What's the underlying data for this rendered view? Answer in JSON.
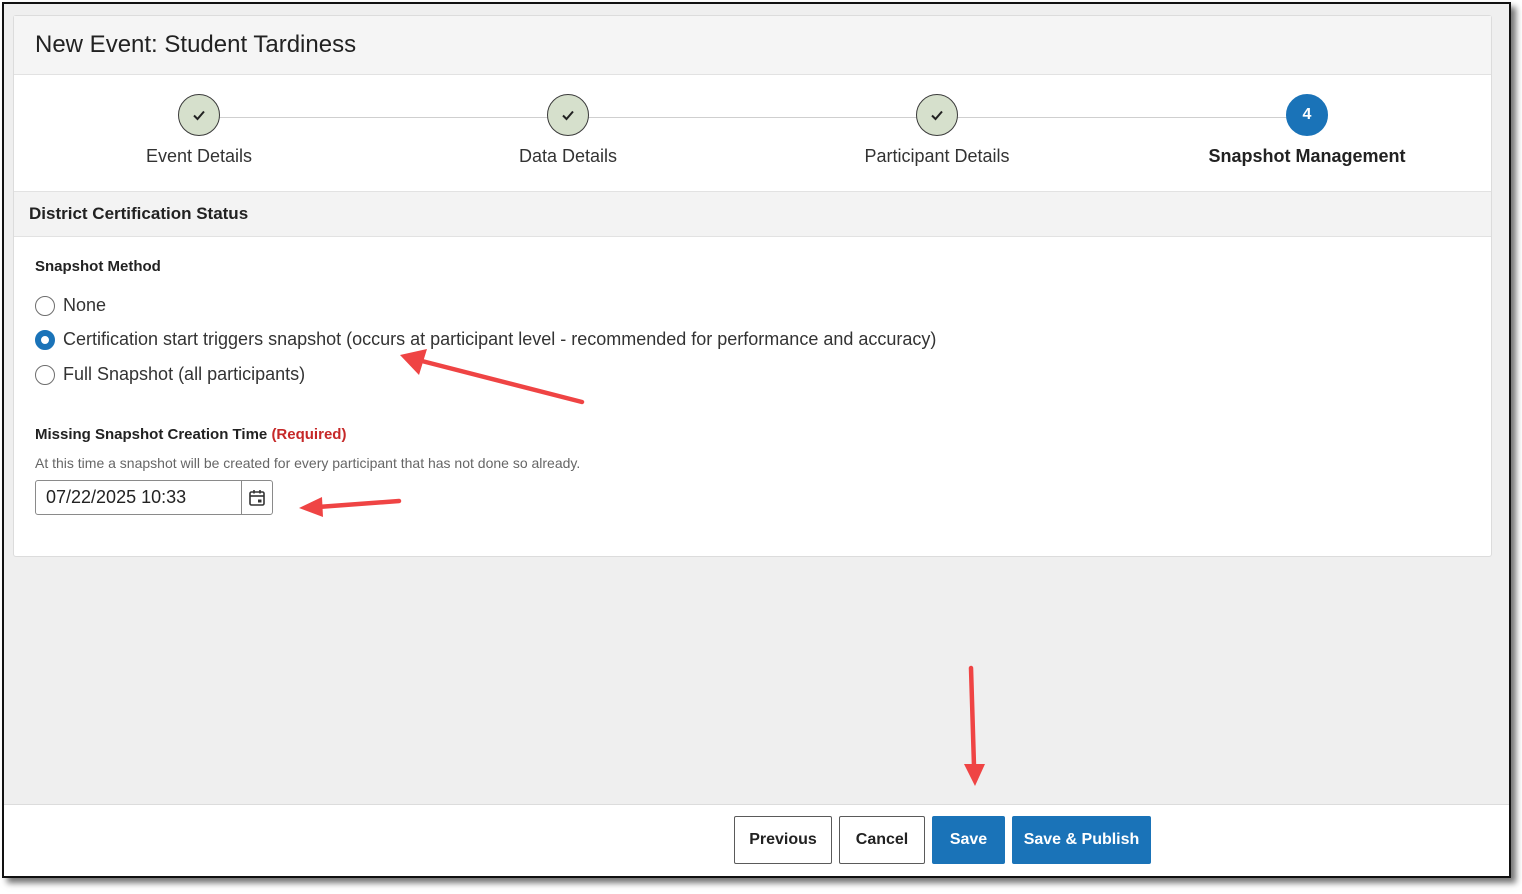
{
  "window": {
    "title": "New Event: Student Tardiness"
  },
  "stepper": {
    "steps": [
      {
        "label": "Event Details",
        "state": "complete"
      },
      {
        "label": "Data Details",
        "state": "complete"
      },
      {
        "label": "Participant Details",
        "state": "complete"
      },
      {
        "label": "Snapshot Management",
        "state": "current",
        "number": "4"
      }
    ]
  },
  "section": {
    "title": "District Certification Status"
  },
  "snapshot_method": {
    "label": "Snapshot Method",
    "options": [
      {
        "label": "None",
        "checked": false
      },
      {
        "label": "Certification start triggers snapshot (occurs at participant level - recommended for performance and accuracy)",
        "checked": true
      },
      {
        "label": "Full Snapshot (all participants)",
        "checked": false
      }
    ]
  },
  "missing_snapshot": {
    "label": "Missing Snapshot Creation Time",
    "required_text": "(Required)",
    "help": "At this time a snapshot will be created for every participant that has not done so already.",
    "value": "07/22/2025 10:33",
    "icon": "calendar-icon"
  },
  "footer": {
    "previous_label": "Previous",
    "cancel_label": "Cancel",
    "save_label": "Save",
    "save_publish_label": "Save & Publish"
  },
  "colors": {
    "primary": "#1a73b8",
    "step_complete": "#d6e0cc",
    "required": "#c62828",
    "annotation_arrow": "#ef4444"
  }
}
